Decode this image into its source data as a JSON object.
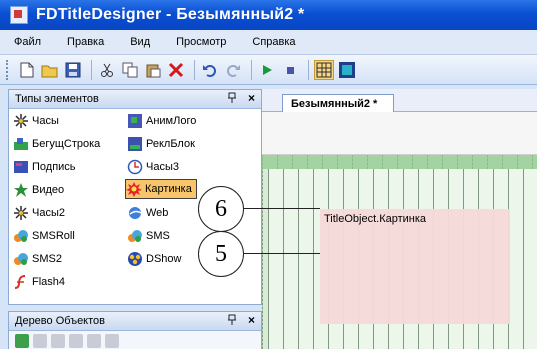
{
  "window": {
    "title": "FDTitleDesigner - Безымянный2 *"
  },
  "menu": [
    {
      "label": "Файл"
    },
    {
      "label": "Правка"
    },
    {
      "label": "Вид"
    },
    {
      "label": "Просмотр"
    },
    {
      "label": "Справка"
    }
  ],
  "toolbar": {
    "icons": [
      "new-icon",
      "open-icon",
      "save-icon",
      "cut-icon",
      "copy-icon",
      "paste-icon",
      "delete-icon",
      "undo-icon",
      "redo-icon",
      "play-icon",
      "stop-icon",
      "grid-icon",
      "frame-icon"
    ]
  },
  "element_panel": {
    "title": "Типы элементов",
    "pin": "ᵖ",
    "close": "×",
    "items_left": [
      {
        "label": "Часы",
        "icon": "clock-star-icon"
      },
      {
        "label": "БегущСтрока",
        "icon": "ticker-icon"
      },
      {
        "label": "Подпись",
        "icon": "caption-icon"
      },
      {
        "label": "Видео",
        "icon": "video-icon"
      },
      {
        "label": "Часы2",
        "icon": "clock2-icon"
      },
      {
        "label": "SMSRoll",
        "icon": "sms-roll-icon"
      },
      {
        "label": "SMS2",
        "icon": "sms2-icon"
      },
      {
        "label": "Flash4",
        "icon": "flash-icon"
      }
    ],
    "items_right": [
      {
        "label": "АнимЛого",
        "icon": "anim-logo-icon"
      },
      {
        "label": "РеклБлок",
        "icon": "ad-block-icon"
      },
      {
        "label": "Часы3",
        "icon": "clock3-icon"
      },
      {
        "label": "Картинка",
        "icon": "picture-icon"
      },
      {
        "label": "Web",
        "icon": "web-icon"
      },
      {
        "label": "SMS",
        "icon": "sms-icon"
      },
      {
        "label": "DShow",
        "icon": "dshow-icon"
      }
    ],
    "selected": "Картинка"
  },
  "object_tree_panel": {
    "title": "Дерево Объектов",
    "pin": "ᵖ",
    "close": "×"
  },
  "document": {
    "tab_label": "Безымянный2 *",
    "title_object_label": "TitleObject.Картинка"
  },
  "callouts": [
    {
      "label": "6"
    },
    {
      "label": "5"
    }
  ],
  "colors": {
    "titlebar": "#0a4fd2",
    "selected_item": "#f9c56b",
    "canvas_green": "#d8ecd6",
    "title_object_pink": "#f6dada"
  }
}
